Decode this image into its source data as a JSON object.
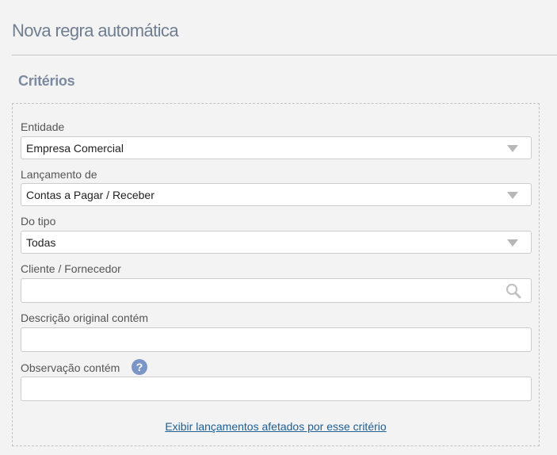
{
  "page": {
    "title": "Nova regra automática"
  },
  "section": {
    "title": "Critérios"
  },
  "fields": {
    "entidade": {
      "label": "Entidade",
      "value": "Empresa Comercial"
    },
    "lancamento": {
      "label": "Lançamento de",
      "value": "Contas a Pagar / Receber"
    },
    "tipo": {
      "label": "Do tipo",
      "value": "Todas"
    },
    "cliente": {
      "label": "Cliente / Fornecedor",
      "value": "",
      "icon": "search-icon"
    },
    "descricao": {
      "label": "Descrição original contém",
      "value": ""
    },
    "observacao": {
      "label": "Observação contém",
      "value": "",
      "help_icon": "question-icon"
    }
  },
  "link": {
    "text": "Exibir lançamentos afetados por esse critério"
  },
  "colors": {
    "title": "#6f7e90",
    "section": "#7c8aa0",
    "link": "#1f5e91",
    "help_icon": "#7b96c6"
  }
}
